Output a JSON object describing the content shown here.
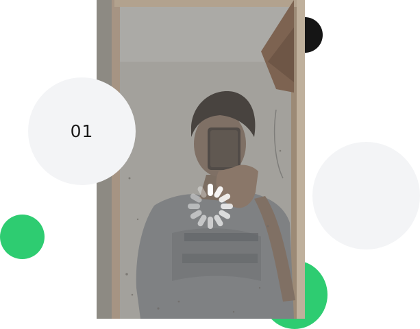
{
  "slide": {
    "number_badge": "01"
  },
  "colors": {
    "accent_green": "#2ecc71",
    "dark_dot": "#151515",
    "light_circle": "#f3f4f6",
    "badge_text": "#1a1a1a"
  },
  "photo": {
    "subject": "mirror-selfie"
  },
  "loading": {
    "icon": "loading-spinner-icon"
  }
}
